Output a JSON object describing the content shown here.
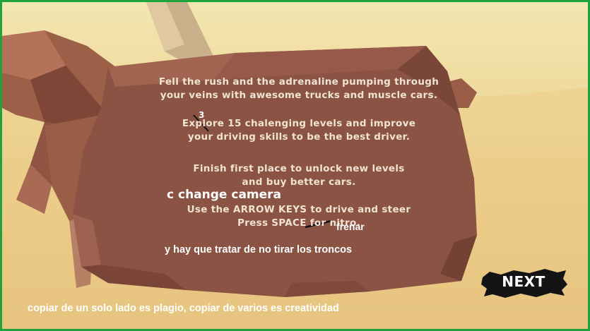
{
  "instructions": {
    "line1": "Fell the rush and the adrenaline pumping through",
    "line2": "your veins with awesome trucks and muscle cars.",
    "line3": "Explore 15 chalenging levels and improve",
    "line4": "your driving skills to be the best driver.",
    "line5": "Finish first place to unlock new levels",
    "line6": "and buy better cars.",
    "line7": "Use the ARROW KEYS to drive and steer",
    "line8": "Press SPACE for nitro."
  },
  "annotations": {
    "level_correction": "3",
    "camera_hint": "c change camera",
    "brake_hint": "frenar",
    "logs_hint": "y hay que tratar de no tirar los troncos",
    "footer_note": "copiar de un solo lado es plagio, copiar de varios es creatividad"
  },
  "buttons": {
    "next_label": "NEXT"
  },
  "colors": {
    "frame_border": "#1fa33a",
    "rock_panel": "#8a5343",
    "instruction_text": "#f3e3d3",
    "sand": "#e8c47c"
  }
}
